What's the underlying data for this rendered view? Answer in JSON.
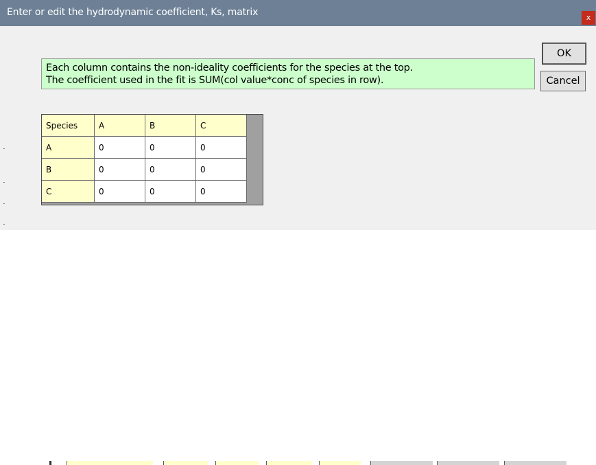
{
  "dialog": {
    "title": "Enter or edit the hydrodynamic coefficient, Ks, matrix",
    "close_label": "x",
    "info_lines": [
      "Each column contains the non-ideality coefficients for the species at the top.",
      "The coefficient used in the fit is SUM(col value*conc of species in row)."
    ],
    "ok_label": "OK",
    "cancel_label": "Cancel"
  },
  "matrix": {
    "corner_label": "Species",
    "columns": [
      "A",
      "B",
      "C"
    ],
    "rows": [
      {
        "species": "A",
        "values": [
          "0",
          "0",
          "0"
        ]
      },
      {
        "species": "B",
        "values": [
          "0",
          "0",
          "0"
        ]
      },
      {
        "species": "C",
        "values": [
          "0",
          "0",
          "0"
        ]
      }
    ]
  },
  "colors": {
    "titlebar": "#6d8096",
    "close_button": "#c42b1c",
    "info_background": "#ccffcc",
    "header_cell": "#ffffcc",
    "data_cell": "#ffffff",
    "dialog_background": "#f0f0f0"
  }
}
